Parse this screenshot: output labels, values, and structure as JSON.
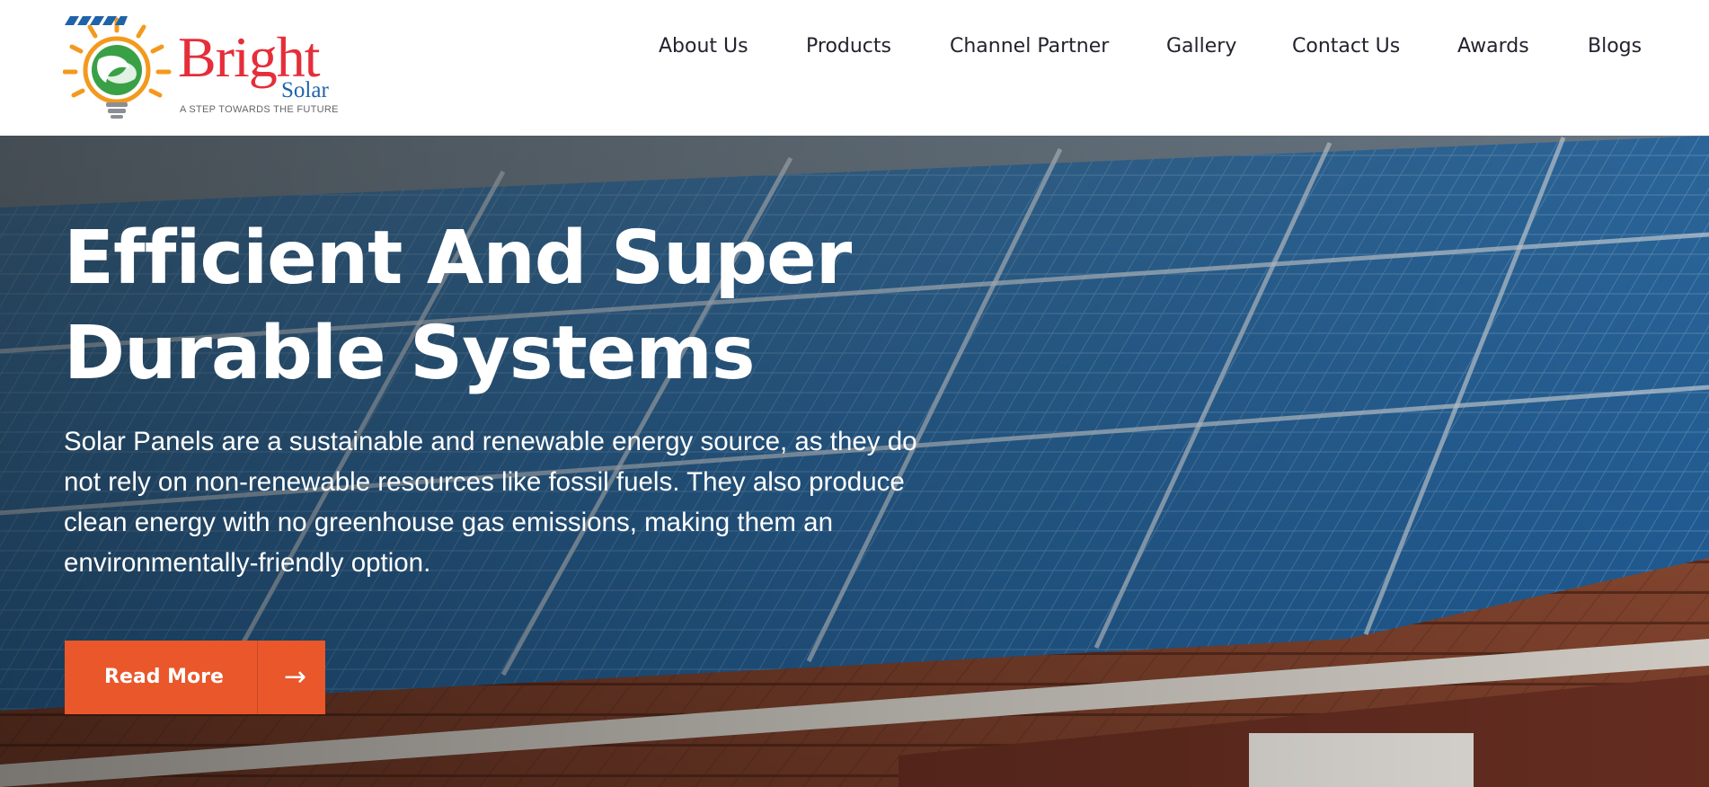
{
  "brand": {
    "name": "Bright",
    "sub": "Solar",
    "tagline": "A STEP TOWARDS THE FUTURE",
    "colors": {
      "red": "#e52e3a",
      "blue": "#1f63a8",
      "orange": "#f39a1e",
      "green": "#3aa046"
    }
  },
  "nav": {
    "items": [
      "About Us",
      "Products",
      "Channel Partner",
      "Gallery",
      "Contact Us",
      "Awards",
      "Blogs"
    ]
  },
  "hero": {
    "title_line1": "Efficient And Super",
    "title_line2": "Durable Systems",
    "description": "Solar Panels are a sustainable and renewable energy source, as they do not rely on non-renewable resources like fossil fuels. They also produce clean energy with no greenhouse gas emissions, making them an environmentally-friendly option.",
    "cta_label": "Read More",
    "cta_icon": "arrow-right-icon",
    "cta_color": "#e9572a"
  }
}
